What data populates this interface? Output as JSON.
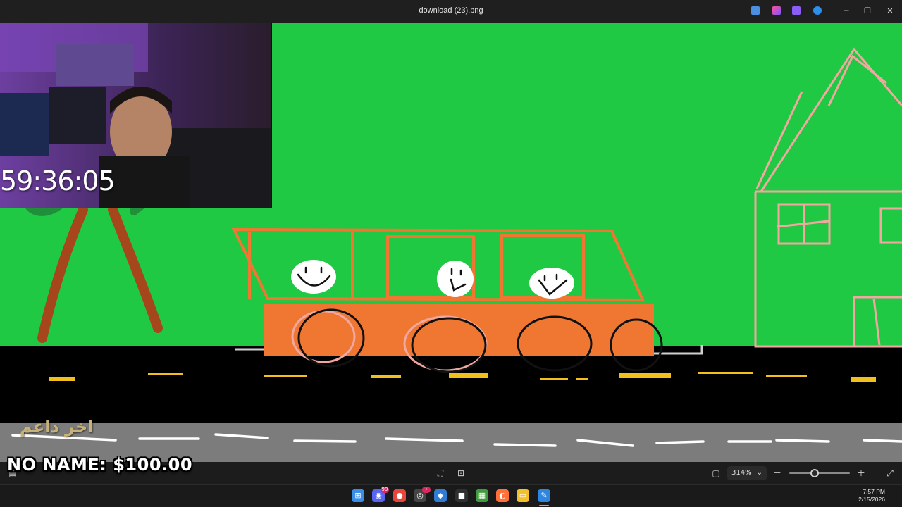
{
  "window": {
    "title": "download (23).png",
    "minimize_label": "─",
    "maximize_label": "❐",
    "close_label": "✕"
  },
  "stream_overlay": {
    "timer": "59:36:05",
    "last_supporter_label": "اخر داعم",
    "donation_text": "NO NAME: $100.00"
  },
  "statusbar": {
    "zoom_value": "314%",
    "zoom_dropdown_glyph": "⌄",
    "zoom_out_glyph": "－",
    "zoom_in_glyph": "＋",
    "zoom_slider_fraction": 0.42
  },
  "taskbar": {
    "apps": [
      {
        "name": "start",
        "glyph": "⊞",
        "color": "#3a8ee6"
      },
      {
        "name": "discord",
        "glyph": "◉",
        "color": "#5865f2",
        "badge": "99"
      },
      {
        "name": "chrome",
        "glyph": "●",
        "color": "#e8453c"
      },
      {
        "name": "obs",
        "glyph": "◎",
        "color": "#444444",
        "badge": "•"
      },
      {
        "name": "app-blue",
        "glyph": "◆",
        "color": "#2f7cd6"
      },
      {
        "name": "app-dark",
        "glyph": "■",
        "color": "#303030"
      },
      {
        "name": "minecraft",
        "glyph": "▦",
        "color": "#3f9b3c"
      },
      {
        "name": "firefox",
        "glyph": "◐",
        "color": "#ff7139"
      },
      {
        "name": "file-explorer",
        "glyph": "▭",
        "color": "#f2c02c"
      },
      {
        "name": "paint",
        "glyph": "✎",
        "color": "#2d87e0"
      }
    ],
    "time": "7:57 PM",
    "date": "2/15/2026"
  },
  "colors": {
    "canvas_green": "#20c944",
    "road": "#000000",
    "lower_road": "#7c7c7c",
    "bus_orange": "#f07731",
    "house_pink": "#f2a8a0",
    "lane_yellow": "#f2c01c"
  }
}
